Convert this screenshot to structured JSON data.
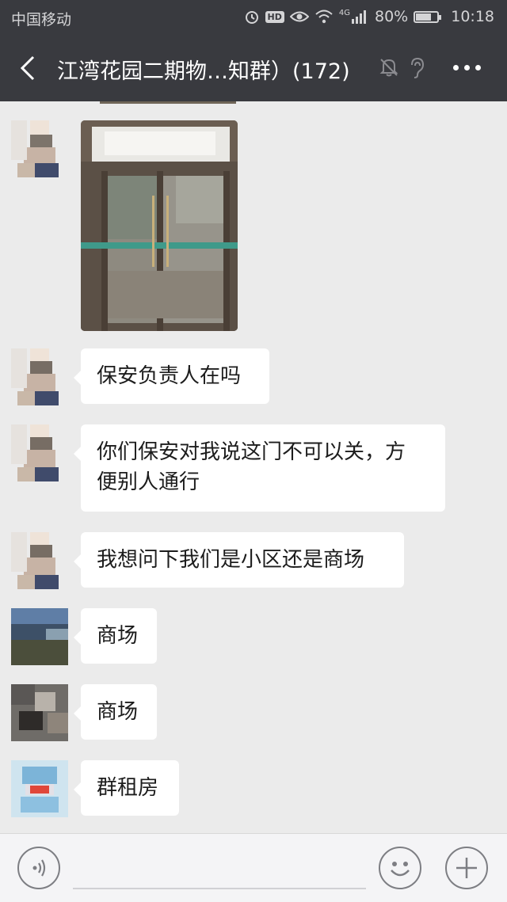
{
  "status_bar": {
    "carrier": "中国移动",
    "hd": "HD",
    "network": "4G",
    "battery_text": "80%",
    "battery_level": 0.8,
    "time": "10:18",
    "icons": [
      "alarm-icon",
      "hd-icon",
      "eye-icon",
      "wifi-icon",
      "signal-icon",
      "battery-icon"
    ]
  },
  "header": {
    "title": "江湾花园二期物…知群）(172)",
    "icons": [
      "back-icon",
      "mute-bell-icon",
      "ear-icon",
      "more-icon"
    ]
  },
  "messages": [
    {
      "type": "image",
      "avatar": "blurred-avatar",
      "content": "glass-door-photo"
    },
    {
      "type": "text",
      "avatar": "blurred-avatar",
      "text": "保安负责人在吗"
    },
    {
      "type": "text",
      "avatar": "blurred-avatar",
      "text_line1": "你们保安对我说这门不可以关，方",
      "text_line2": "便别人通行"
    },
    {
      "type": "text",
      "avatar": "blurred-avatar",
      "text": "我想问下我们是小区还是商场"
    },
    {
      "type": "text",
      "avatar": "landscape-avatar",
      "text": "商场"
    },
    {
      "type": "text",
      "avatar": "dark-avatar",
      "text": "商场"
    },
    {
      "type": "text",
      "avatar": "cartoon-avatar",
      "text": "群租房"
    }
  ],
  "input_bar": {
    "placeholder": "",
    "icons": [
      "voice-icon",
      "emoji-icon",
      "plus-icon"
    ]
  }
}
